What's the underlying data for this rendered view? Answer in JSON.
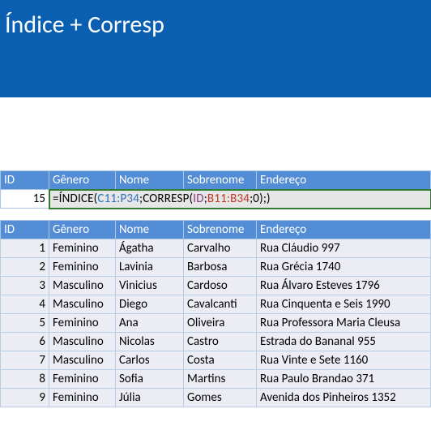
{
  "title": "Índice + Corresp",
  "headers": {
    "id": "ID",
    "genero": "Gênero",
    "nome": "Nome",
    "sobrenome": "Sobrenome",
    "endereco": "Endereço"
  },
  "lookup": {
    "id_value": "15",
    "formula_parts": {
      "p1": "=ÍNDICE(",
      "p2": "C11:P34",
      "p3": ";CORRESP(",
      "p4": "ID",
      "p5": ";",
      "p6": "B11:B34",
      "p7": ";0);)"
    }
  },
  "rows": [
    {
      "id": "1",
      "genero": "Feminino",
      "nome": "Ágatha",
      "sobrenome": "Carvalho",
      "endereco": "Rua Cláudio 997"
    },
    {
      "id": "2",
      "genero": "Feminino",
      "nome": "Lavinia",
      "sobrenome": "Barbosa",
      "endereco": "Rua Grécia 1740"
    },
    {
      "id": "3",
      "genero": "Masculino",
      "nome": "Vinicius",
      "sobrenome": "Cardoso",
      "endereco": "Rua Álvaro Esteves 1796"
    },
    {
      "id": "4",
      "genero": "Masculino",
      "nome": "Diego",
      "sobrenome": "Cavalcanti",
      "endereco": "Rua Cinquenta e Seis 1990"
    },
    {
      "id": "5",
      "genero": "Feminino",
      "nome": "Ana",
      "sobrenome": "Oliveira",
      "endereco": "Rua Professora Maria Cleusa"
    },
    {
      "id": "6",
      "genero": "Masculino",
      "nome": "Nicolas",
      "sobrenome": "Castro",
      "endereco": "Estrada do Bananal 955"
    },
    {
      "id": "7",
      "genero": "Masculino",
      "nome": "Carlos",
      "sobrenome": "Costa",
      "endereco": "Rua Vinte e Sete 1160"
    },
    {
      "id": "8",
      "genero": "Feminino",
      "nome": "Sofia",
      "sobrenome": "Martins",
      "endereco": "Rua Paulo Brandao 371"
    },
    {
      "id": "9",
      "genero": "Feminino",
      "nome": "Júlia",
      "sobrenome": "Gomes",
      "endereco": "Avenida dos Pinheiros 1352"
    }
  ]
}
